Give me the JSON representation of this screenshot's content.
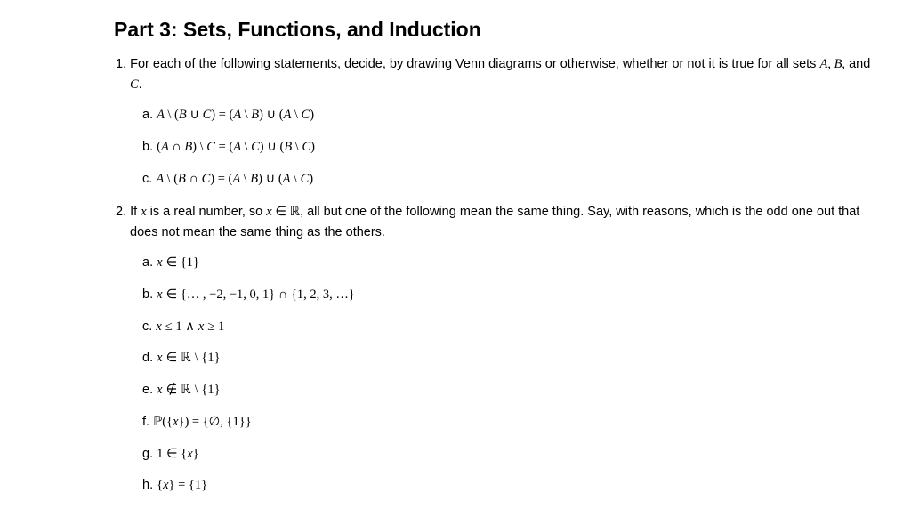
{
  "title": "Part 3: Sets, Functions, and Induction",
  "questions": [
    {
      "number": "1.",
      "text_pre": "For each of the following statements, decide, by drawing Venn diagrams or otherwise, whether or not it is true for all sets ",
      "text_math": "A, B,",
      "text_mid": " and ",
      "text_math2": "C",
      "text_post": ".",
      "items": [
        {
          "label": "a.",
          "expr": "A \\ (B ∪ C) = (A \\ B) ∪ (A \\ C)"
        },
        {
          "label": "b.",
          "expr": "(A ∩ B) \\ C = (A \\ C) ∪ (B \\ C)"
        },
        {
          "label": "c.",
          "expr": "A \\ (B ∩ C) = (A \\ B) ∪ (A \\ C)"
        }
      ]
    },
    {
      "number": "2.",
      "text_pre": "If ",
      "text_var": "x",
      "text_mid1": " is a real number, so ",
      "text_expr": "x ∈ ℝ",
      "text_post": ", all but one of the following mean the same thing. Say, with reasons, which is the odd one out that does not mean the same thing as the others.",
      "items": [
        {
          "label": "a.",
          "expr": "x ∈ {1}"
        },
        {
          "label": "b.",
          "expr": "x ∈ {… , −2, −1, 0, 1} ∩ {1, 2, 3, …}"
        },
        {
          "label": "c.",
          "expr": "x ≤ 1 ∧ x ≥ 1"
        },
        {
          "label": "d.",
          "expr": "x ∈ ℝ \\ {1}"
        },
        {
          "label": "e.",
          "expr": "x ∉ ℝ \\ {1}"
        },
        {
          "label": "f.",
          "expr": "ℙ({x}) = {∅, {1}}"
        },
        {
          "label": "g.",
          "expr": "1 ∈ {x}"
        },
        {
          "label": "h.",
          "expr": "{x} = {1}"
        }
      ]
    }
  ]
}
